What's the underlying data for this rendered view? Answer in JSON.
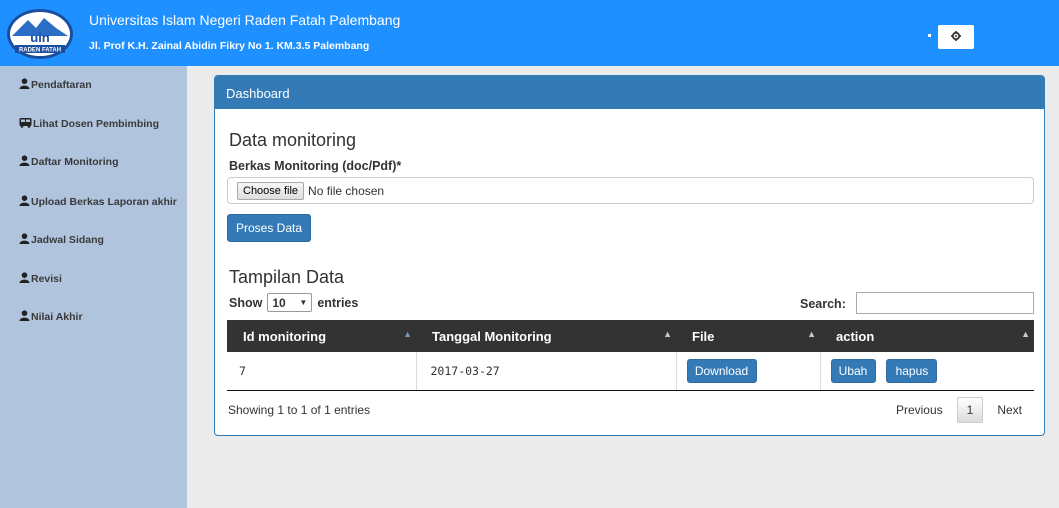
{
  "header": {
    "title": "Universitas Islam Negeri Raden Fatah Palembang",
    "subtitle": "Jl. Prof K.H. Zainal Abidin Fikry No 1. KM.3.5 Palembang",
    "logo_text": "uin",
    "logo_sub": "RADEN FATAH",
    "settings_icon": "gear-icon",
    "brand_color": "#1e90ff"
  },
  "sidebar": {
    "items": [
      {
        "label": "Pendaftaran",
        "icon": "user-icon"
      },
      {
        "label": "Lihat Dosen Pembimbing",
        "icon": "bus-icon"
      },
      {
        "label": "Daftar Monitoring",
        "icon": "user-icon"
      },
      {
        "label": "Upload Berkas Laporan akhir",
        "icon": "user-icon"
      },
      {
        "label": "Jadwal Sidang",
        "icon": "user-icon"
      },
      {
        "label": "Revisi",
        "icon": "user-icon"
      },
      {
        "label": "Nilai Akhir",
        "icon": "user-icon"
      }
    ]
  },
  "panel": {
    "title": "Dashboard",
    "form_heading": "Data monitoring",
    "field_label": "Berkas Monitoring (doc/Pdf)*",
    "choose_file": "Choose file",
    "no_file": "No file chosen",
    "submit_label": "Proses Data",
    "data_heading": "Tampilan Data"
  },
  "table": {
    "show_label": "Show",
    "page_length": "10",
    "entries_label": "entries",
    "search_label": "Search:",
    "columns": [
      "Id monitoring",
      "Tanggal Monitoring",
      "File",
      "action"
    ],
    "rows": [
      {
        "id": "7",
        "date": "2017-03-27",
        "download": "Download",
        "edit": "Ubah",
        "delete": "hapus"
      }
    ],
    "info": "Showing 1 to 1 of 1 entries",
    "prev": "Previous",
    "page": "1",
    "next": "Next"
  }
}
